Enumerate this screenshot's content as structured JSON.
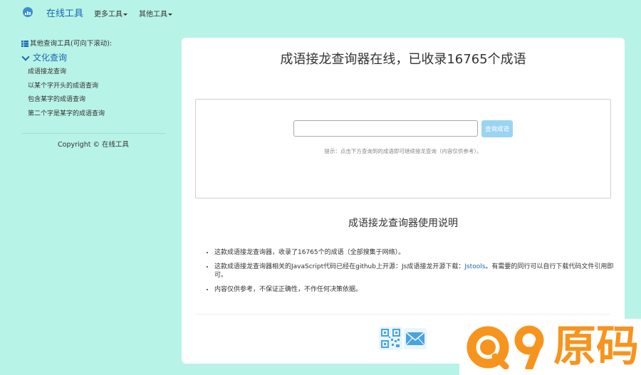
{
  "navbar": {
    "brand": "在线工具",
    "more_tools": "更多工具",
    "other_tools": "其他工具"
  },
  "sidebar": {
    "heading": "其他查询工具(可向下滚动):",
    "category": "文化查询",
    "items": [
      {
        "label": "成语接龙查询"
      },
      {
        "label": "以某个字开头的成语查询"
      },
      {
        "label": "包含某字的成语查询"
      },
      {
        "label": "第二个字是某字的成语查询"
      }
    ],
    "copyright": "Copyright © 在线工具"
  },
  "main": {
    "title": "成语接龙查询器在线，已收录16765个成语",
    "search": {
      "value": "",
      "placeholder": "",
      "button_label": "查询成语",
      "hint": "提示：点击下方查询到的成语即可继续接龙查询（内容仅供参考）。"
    },
    "usage_title": "成语接龙查询器使用说明",
    "notes": {
      "n1": "这款成语接龙查询器，收录了16765个的成语（全部搜集于网络）。",
      "n2_before": "这款成语接龙查询器相关的JavaScript代码已经在github上开源：Js成语接龙开源下载：",
      "n2_link": "Jstools",
      "n2_after": "。有需要的同行可以自行下载代码文件引用即可。",
      "n3": "内容仅供参考，不保证正确性，不作任何决策依据。"
    }
  },
  "footer_icons": [
    "qrcode-icon",
    "mail-icon"
  ],
  "watermark": {
    "text": "原码",
    "logo_text": "Q9"
  },
  "colors": {
    "background": "#b8f3e7",
    "brand": "#1a66b3",
    "button": "#9ad4f2",
    "watermark": "#f7941d"
  }
}
